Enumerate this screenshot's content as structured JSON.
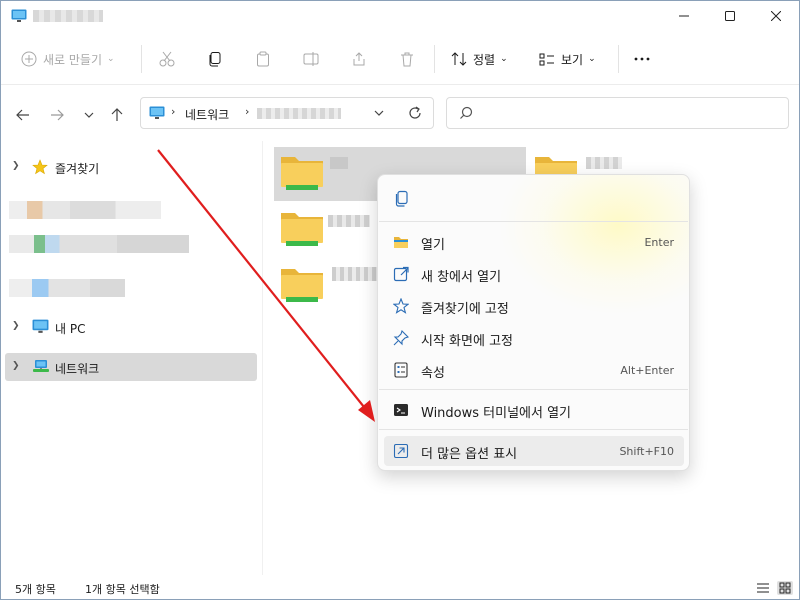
{
  "toolbar": {
    "new_label": "새로 만들기",
    "sort_label": "정렬",
    "view_label": "보기"
  },
  "address": {
    "crumb_1": "네트워크"
  },
  "sidebar": {
    "favorites": "즐겨찾기",
    "this_pc": "내 PC",
    "network": "네트워크"
  },
  "context_menu": {
    "items": [
      {
        "label": "열기",
        "shortcut": "Enter",
        "icon": "folder-open-icon"
      },
      {
        "label": "새 창에서 열기",
        "shortcut": "",
        "icon": "new-window-icon"
      },
      {
        "label": "즐겨찾기에 고정",
        "shortcut": "",
        "icon": "star-icon"
      },
      {
        "label": "시작 화면에 고정",
        "shortcut": "",
        "icon": "pin-icon"
      },
      {
        "label": "속성",
        "shortcut": "Alt+Enter",
        "icon": "properties-icon"
      },
      {
        "label": "Windows 터미널에서 열기",
        "shortcut": "",
        "icon": "terminal-icon"
      },
      {
        "label": "더 많은 옵션 표시",
        "shortcut": "Shift+F10",
        "icon": "more-options-icon"
      }
    ]
  },
  "status": {
    "item_count": "5개 항목",
    "selected_count": "1개 항목 선택함"
  },
  "colors": {
    "folder_yellow": "#f8cf5c",
    "folder_dark": "#e8b53a",
    "network_green": "#3cb94a",
    "pc_blue": "#2b8fd6",
    "arrow_red": "#e01e1e",
    "selection": "#d9d9d9"
  }
}
